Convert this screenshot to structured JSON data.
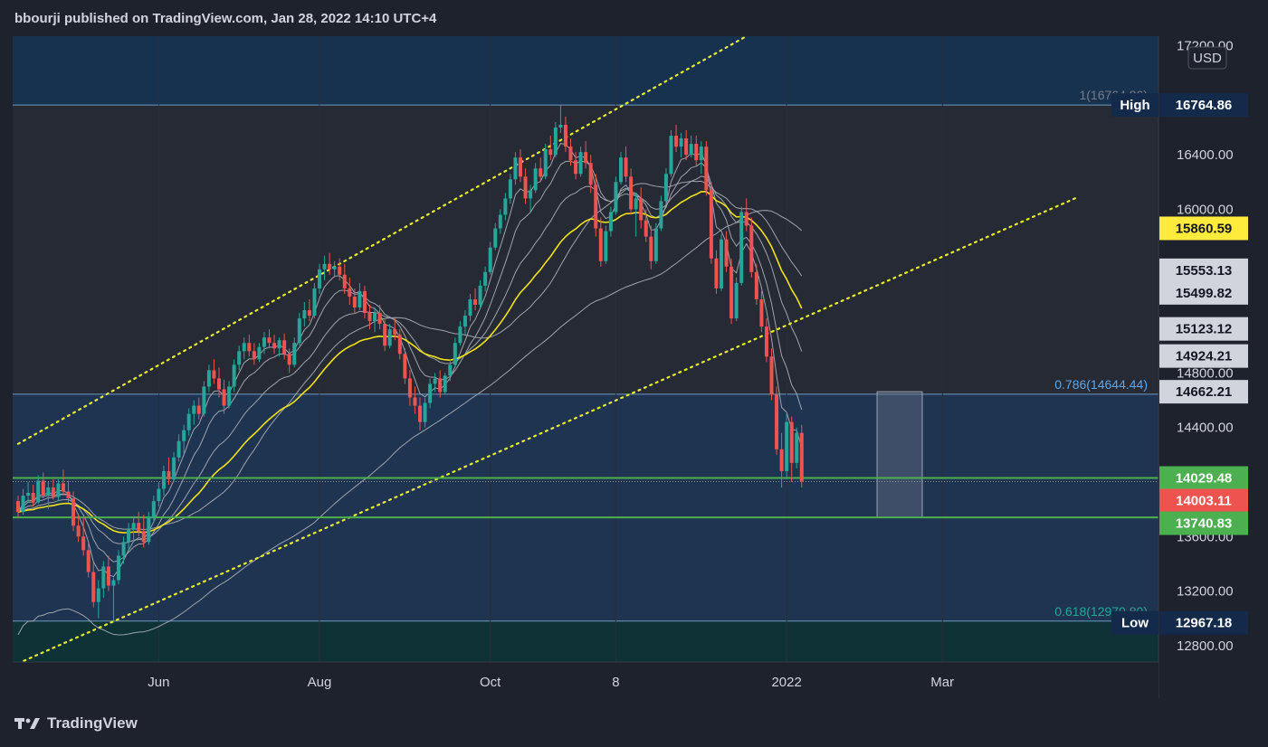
{
  "header": {
    "publisher": "bbourji published on TradingView.com, Jan 28, 2022 14:10 UTC+4"
  },
  "footer": {
    "brand": "TradingView"
  },
  "currency": "USD",
  "colors": {
    "bull": "#26a69a",
    "bear": "#ef5350",
    "ema50": "#f2e21a",
    "ma_gray": "#9fa3ab",
    "channel": "#e8ec2c",
    "support": "#4caf50",
    "fib_line": "#7fb4e0",
    "fib_label": "#5ea6e8",
    "fib_low_label": "#26a69a",
    "high_tag": "#132a4a",
    "low_tag": "#132a4a",
    "zone_top": "#17324e",
    "zone_mid": "#1f3450",
    "zone_low": "#0f3236"
  },
  "chart_data": {
    "type": "candlestick",
    "title": "",
    "x_ticks": [
      "Jun",
      "Aug",
      "Oct",
      "8",
      "2022",
      "Mar"
    ],
    "y_ticks": [
      17200,
      16400,
      16000,
      14800,
      14400,
      13600,
      13200,
      12800
    ],
    "ylim": [
      12680,
      17270
    ],
    "price_tags": [
      {
        "label": "High",
        "value": 16764.86,
        "style": "navy"
      },
      {
        "value": 15860.59,
        "style": "yellow"
      },
      {
        "value": 15553.13,
        "style": "light"
      },
      {
        "value": 15499.82,
        "style": "light"
      },
      {
        "value": 15123.12,
        "style": "light"
      },
      {
        "value": 14924.21,
        "style": "light"
      },
      {
        "value": 14662.21,
        "style": "light"
      },
      {
        "value": 14029.48,
        "style": "green"
      },
      {
        "value": 14003.11,
        "style": "red"
      },
      {
        "value": 13740.83,
        "style": "green"
      },
      {
        "label": "Low",
        "value": 12967.18,
        "style": "navy"
      }
    ],
    "fib_levels": [
      {
        "label": "1(16764.86)",
        "value": 16764.86
      },
      {
        "label": "0.786(14644.44)",
        "value": 14644.44
      },
      {
        "label": "0.618(12979.80)",
        "value": 12979.8
      }
    ],
    "horizontal_support": [
      14029.48,
      13740.83
    ],
    "channel_upper": [
      [
        0,
        14280
      ],
      [
        145,
        17270
      ]
    ],
    "channel_lower": [
      [
        0,
        12670
      ],
      [
        211,
        16090
      ]
    ],
    "box": {
      "x0": 171,
      "x1": 180,
      "y0": 13740.83,
      "y1": 14662.21
    },
    "x_tick_positions": [
      28,
      60,
      94,
      119,
      153,
      184
    ],
    "candles": [
      {
        "o": 13860,
        "h": 13900,
        "l": 13740,
        "c": 13780
      },
      {
        "o": 13780,
        "h": 13950,
        "l": 13760,
        "c": 13900
      },
      {
        "o": 13900,
        "h": 14000,
        "l": 13850,
        "c": 13920
      },
      {
        "o": 13920,
        "h": 13980,
        "l": 13820,
        "c": 13850
      },
      {
        "o": 13850,
        "h": 14050,
        "l": 13840,
        "c": 14010
      },
      {
        "o": 14010,
        "h": 14070,
        "l": 13880,
        "c": 13900
      },
      {
        "o": 13900,
        "h": 14000,
        "l": 13800,
        "c": 13960
      },
      {
        "o": 13960,
        "h": 14020,
        "l": 13870,
        "c": 13890
      },
      {
        "o": 13890,
        "h": 14020,
        "l": 13860,
        "c": 13990
      },
      {
        "o": 13990,
        "h": 14090,
        "l": 13900,
        "c": 13930
      },
      {
        "o": 13930,
        "h": 14010,
        "l": 13850,
        "c": 13880
      },
      {
        "o": 13880,
        "h": 13930,
        "l": 13640,
        "c": 13680
      },
      {
        "o": 13680,
        "h": 13760,
        "l": 13560,
        "c": 13600
      },
      {
        "o": 13600,
        "h": 13740,
        "l": 13460,
        "c": 13500
      },
      {
        "o": 13500,
        "h": 13560,
        "l": 13300,
        "c": 13340
      },
      {
        "o": 13340,
        "h": 13420,
        "l": 13080,
        "c": 13120
      },
      {
        "o": 13120,
        "h": 13280,
        "l": 13000,
        "c": 13220
      },
      {
        "o": 13220,
        "h": 13420,
        "l": 13150,
        "c": 13380
      },
      {
        "o": 13380,
        "h": 13460,
        "l": 13200,
        "c": 13240
      },
      {
        "o": 13240,
        "h": 13300,
        "l": 12970,
        "c": 13280
      },
      {
        "o": 13280,
        "h": 13500,
        "l": 13250,
        "c": 13460
      },
      {
        "o": 13460,
        "h": 13600,
        "l": 13400,
        "c": 13560
      },
      {
        "o": 13560,
        "h": 13700,
        "l": 13500,
        "c": 13650
      },
      {
        "o": 13650,
        "h": 13750,
        "l": 13560,
        "c": 13700
      },
      {
        "o": 13700,
        "h": 13780,
        "l": 13600,
        "c": 13640
      },
      {
        "o": 13640,
        "h": 13760,
        "l": 13520,
        "c": 13560
      },
      {
        "o": 13560,
        "h": 13780,
        "l": 13540,
        "c": 13740
      },
      {
        "o": 13740,
        "h": 13900,
        "l": 13700,
        "c": 13860
      },
      {
        "o": 13860,
        "h": 14000,
        "l": 13820,
        "c": 13950
      },
      {
        "o": 13950,
        "h": 14120,
        "l": 13900,
        "c": 14080
      },
      {
        "o": 14080,
        "h": 14180,
        "l": 13980,
        "c": 14020
      },
      {
        "o": 14020,
        "h": 14220,
        "l": 14000,
        "c": 14180
      },
      {
        "o": 14180,
        "h": 14350,
        "l": 14150,
        "c": 14300
      },
      {
        "o": 14300,
        "h": 14420,
        "l": 14200,
        "c": 14380
      },
      {
        "o": 14380,
        "h": 14540,
        "l": 14340,
        "c": 14500
      },
      {
        "o": 14500,
        "h": 14600,
        "l": 14420,
        "c": 14560
      },
      {
        "o": 14560,
        "h": 14620,
        "l": 14460,
        "c": 14500
      },
      {
        "o": 14500,
        "h": 14740,
        "l": 14480,
        "c": 14700
      },
      {
        "o": 14700,
        "h": 14860,
        "l": 14660,
        "c": 14820
      },
      {
        "o": 14820,
        "h": 14900,
        "l": 14720,
        "c": 14760
      },
      {
        "o": 14760,
        "h": 14840,
        "l": 14620,
        "c": 14680
      },
      {
        "o": 14680,
        "h": 14750,
        "l": 14500,
        "c": 14560
      },
      {
        "o": 14560,
        "h": 14740,
        "l": 14540,
        "c": 14700
      },
      {
        "o": 14700,
        "h": 14900,
        "l": 14660,
        "c": 14860
      },
      {
        "o": 14860,
        "h": 15000,
        "l": 14820,
        "c": 14960
      },
      {
        "o": 14960,
        "h": 15060,
        "l": 14900,
        "c": 15020
      },
      {
        "o": 15020,
        "h": 15080,
        "l": 14920,
        "c": 14960
      },
      {
        "o": 14960,
        "h": 15020,
        "l": 14860,
        "c": 14900
      },
      {
        "o": 14900,
        "h": 15020,
        "l": 14880,
        "c": 14990
      },
      {
        "o": 14990,
        "h": 15100,
        "l": 14940,
        "c": 15060
      },
      {
        "o": 15060,
        "h": 15120,
        "l": 14980,
        "c": 15020
      },
      {
        "o": 15020,
        "h": 15080,
        "l": 14940,
        "c": 14980
      },
      {
        "o": 14980,
        "h": 15060,
        "l": 14920,
        "c": 15040
      },
      {
        "o": 15040,
        "h": 15090,
        "l": 14900,
        "c": 14940
      },
      {
        "o": 14940,
        "h": 14980,
        "l": 14800,
        "c": 14860
      },
      {
        "o": 14860,
        "h": 15060,
        "l": 14840,
        "c": 15020
      },
      {
        "o": 15020,
        "h": 15240,
        "l": 15000,
        "c": 15200
      },
      {
        "o": 15200,
        "h": 15320,
        "l": 15140,
        "c": 15260
      },
      {
        "o": 15260,
        "h": 15340,
        "l": 15180,
        "c": 15220
      },
      {
        "o": 15220,
        "h": 15460,
        "l": 15200,
        "c": 15420
      },
      {
        "o": 15420,
        "h": 15600,
        "l": 15380,
        "c": 15560
      },
      {
        "o": 15560,
        "h": 15660,
        "l": 15480,
        "c": 15600
      },
      {
        "o": 15600,
        "h": 15680,
        "l": 15520,
        "c": 15560
      },
      {
        "o": 15560,
        "h": 15620,
        "l": 15500,
        "c": 15580
      },
      {
        "o": 15580,
        "h": 15640,
        "l": 15480,
        "c": 15520
      },
      {
        "o": 15520,
        "h": 15600,
        "l": 15380,
        "c": 15420
      },
      {
        "o": 15420,
        "h": 15500,
        "l": 15300,
        "c": 15360
      },
      {
        "o": 15360,
        "h": 15420,
        "l": 15240,
        "c": 15280
      },
      {
        "o": 15280,
        "h": 15460,
        "l": 15260,
        "c": 15400
      },
      {
        "o": 15400,
        "h": 15440,
        "l": 15200,
        "c": 15240
      },
      {
        "o": 15240,
        "h": 15300,
        "l": 15120,
        "c": 15180
      },
      {
        "o": 15180,
        "h": 15280,
        "l": 15100,
        "c": 15240
      },
      {
        "o": 15240,
        "h": 15300,
        "l": 15120,
        "c": 15160
      },
      {
        "o": 15160,
        "h": 15200,
        "l": 14960,
        "c": 15000
      },
      {
        "o": 15000,
        "h": 15160,
        "l": 14980,
        "c": 15120
      },
      {
        "o": 15120,
        "h": 15200,
        "l": 15040,
        "c": 15080
      },
      {
        "o": 15080,
        "h": 15120,
        "l": 14900,
        "c": 14940
      },
      {
        "o": 14940,
        "h": 14980,
        "l": 14720,
        "c": 14760
      },
      {
        "o": 14760,
        "h": 14820,
        "l": 14560,
        "c": 14620
      },
      {
        "o": 14620,
        "h": 14700,
        "l": 14500,
        "c": 14560
      },
      {
        "o": 14560,
        "h": 14620,
        "l": 14380,
        "c": 14440
      },
      {
        "o": 14440,
        "h": 14620,
        "l": 14400,
        "c": 14580
      },
      {
        "o": 14580,
        "h": 14760,
        "l": 14540,
        "c": 14720
      },
      {
        "o": 14720,
        "h": 14800,
        "l": 14660,
        "c": 14760
      },
      {
        "o": 14760,
        "h": 14820,
        "l": 14620,
        "c": 14660
      },
      {
        "o": 14660,
        "h": 14800,
        "l": 14640,
        "c": 14780
      },
      {
        "o": 14780,
        "h": 14900,
        "l": 14740,
        "c": 14860
      },
      {
        "o": 14860,
        "h": 15060,
        "l": 14840,
        "c": 15020
      },
      {
        "o": 15020,
        "h": 15180,
        "l": 15000,
        "c": 15140
      },
      {
        "o": 15140,
        "h": 15260,
        "l": 15080,
        "c": 15220
      },
      {
        "o": 15220,
        "h": 15380,
        "l": 15180,
        "c": 15340
      },
      {
        "o": 15340,
        "h": 15420,
        "l": 15260,
        "c": 15300
      },
      {
        "o": 15300,
        "h": 15480,
        "l": 15280,
        "c": 15440
      },
      {
        "o": 15440,
        "h": 15580,
        "l": 15400,
        "c": 15540
      },
      {
        "o": 15540,
        "h": 15760,
        "l": 15520,
        "c": 15720
      },
      {
        "o": 15720,
        "h": 15900,
        "l": 15700,
        "c": 15860
      },
      {
        "o": 15860,
        "h": 16000,
        "l": 15820,
        "c": 15960
      },
      {
        "o": 15960,
        "h": 16120,
        "l": 15920,
        "c": 16080
      },
      {
        "o": 16080,
        "h": 16260,
        "l": 16040,
        "c": 16220
      },
      {
        "o": 16220,
        "h": 16420,
        "l": 16180,
        "c": 16380
      },
      {
        "o": 16380,
        "h": 16440,
        "l": 16200,
        "c": 16240
      },
      {
        "o": 16240,
        "h": 16300,
        "l": 16040,
        "c": 16080
      },
      {
        "o": 16080,
        "h": 16180,
        "l": 15980,
        "c": 16140
      },
      {
        "o": 16140,
        "h": 16340,
        "l": 16120,
        "c": 16300
      },
      {
        "o": 16300,
        "h": 16380,
        "l": 16200,
        "c": 16240
      },
      {
        "o": 16240,
        "h": 16480,
        "l": 16220,
        "c": 16440
      },
      {
        "o": 16440,
        "h": 16540,
        "l": 16360,
        "c": 16400
      },
      {
        "o": 16400,
        "h": 16640,
        "l": 16380,
        "c": 16600
      },
      {
        "o": 16600,
        "h": 16764,
        "l": 16560,
        "c": 16620
      },
      {
        "o": 16620,
        "h": 16680,
        "l": 16420,
        "c": 16460
      },
      {
        "o": 16460,
        "h": 16520,
        "l": 16320,
        "c": 16360
      },
      {
        "o": 16360,
        "h": 16420,
        "l": 16220,
        "c": 16260
      },
      {
        "o": 16260,
        "h": 16460,
        "l": 16240,
        "c": 16420
      },
      {
        "o": 16420,
        "h": 16500,
        "l": 16300,
        "c": 16340
      },
      {
        "o": 16340,
        "h": 16400,
        "l": 16120,
        "c": 16180
      },
      {
        "o": 16180,
        "h": 16260,
        "l": 15800,
        "c": 15860
      },
      {
        "o": 15860,
        "h": 15940,
        "l": 15580,
        "c": 15620
      },
      {
        "o": 15620,
        "h": 15880,
        "l": 15600,
        "c": 15840
      },
      {
        "o": 15840,
        "h": 16020,
        "l": 15800,
        "c": 15980
      },
      {
        "o": 15980,
        "h": 16240,
        "l": 15960,
        "c": 16200
      },
      {
        "o": 16200,
        "h": 16420,
        "l": 16180,
        "c": 16380
      },
      {
        "o": 16380,
        "h": 16460,
        "l": 16200,
        "c": 16240
      },
      {
        "o": 16240,
        "h": 16300,
        "l": 15960,
        "c": 16000
      },
      {
        "o": 16000,
        "h": 16120,
        "l": 15800,
        "c": 16080
      },
      {
        "o": 16080,
        "h": 16160,
        "l": 15860,
        "c": 15920
      },
      {
        "o": 15920,
        "h": 16000,
        "l": 15760,
        "c": 15800
      },
      {
        "o": 15800,
        "h": 15880,
        "l": 15560,
        "c": 15620
      },
      {
        "o": 15620,
        "h": 15900,
        "l": 15600,
        "c": 15860
      },
      {
        "o": 15860,
        "h": 16100,
        "l": 15840,
        "c": 16060
      },
      {
        "o": 16060,
        "h": 16300,
        "l": 16040,
        "c": 16260
      },
      {
        "o": 16260,
        "h": 16580,
        "l": 16240,
        "c": 16540
      },
      {
        "o": 16540,
        "h": 16620,
        "l": 16420,
        "c": 16460
      },
      {
        "o": 16460,
        "h": 16560,
        "l": 16380,
        "c": 16520
      },
      {
        "o": 16520,
        "h": 16580,
        "l": 16360,
        "c": 16400
      },
      {
        "o": 16400,
        "h": 16540,
        "l": 16380,
        "c": 16480
      },
      {
        "o": 16480,
        "h": 16540,
        "l": 16320,
        "c": 16360
      },
      {
        "o": 16360,
        "h": 16500,
        "l": 16260,
        "c": 16460
      },
      {
        "o": 16460,
        "h": 16500,
        "l": 16100,
        "c": 16140
      },
      {
        "o": 16140,
        "h": 16200,
        "l": 15600,
        "c": 15640
      },
      {
        "o": 15640,
        "h": 15700,
        "l": 15380,
        "c": 15420
      },
      {
        "o": 15420,
        "h": 15820,
        "l": 15400,
        "c": 15780
      },
      {
        "o": 15780,
        "h": 15840,
        "l": 15540,
        "c": 15580
      },
      {
        "o": 15580,
        "h": 15640,
        "l": 15160,
        "c": 15200
      },
      {
        "o": 15200,
        "h": 15500,
        "l": 15180,
        "c": 15460
      },
      {
        "o": 15460,
        "h": 16020,
        "l": 15440,
        "c": 15980
      },
      {
        "o": 15980,
        "h": 16080,
        "l": 15840,
        "c": 15880
      },
      {
        "o": 15880,
        "h": 15940,
        "l": 15500,
        "c": 15540
      },
      {
        "o": 15540,
        "h": 15600,
        "l": 15300,
        "c": 15340
      },
      {
        "o": 15340,
        "h": 15400,
        "l": 15100,
        "c": 15140
      },
      {
        "o": 15140,
        "h": 15200,
        "l": 14880,
        "c": 14920
      },
      {
        "o": 14920,
        "h": 14980,
        "l": 14600,
        "c": 14640
      },
      {
        "o": 14640,
        "h": 14700,
        "l": 14200,
        "c": 14240
      },
      {
        "o": 14240,
        "h": 14360,
        "l": 13960,
        "c": 14080
      },
      {
        "o": 14080,
        "h": 14500,
        "l": 14020,
        "c": 14440
      },
      {
        "o": 14440,
        "h": 14480,
        "l": 14000,
        "c": 14140
      },
      {
        "o": 14140,
        "h": 14400,
        "l": 14100,
        "c": 14360
      },
      {
        "o": 14360,
        "h": 14420,
        "l": 13960,
        "c": 14003
      }
    ]
  }
}
